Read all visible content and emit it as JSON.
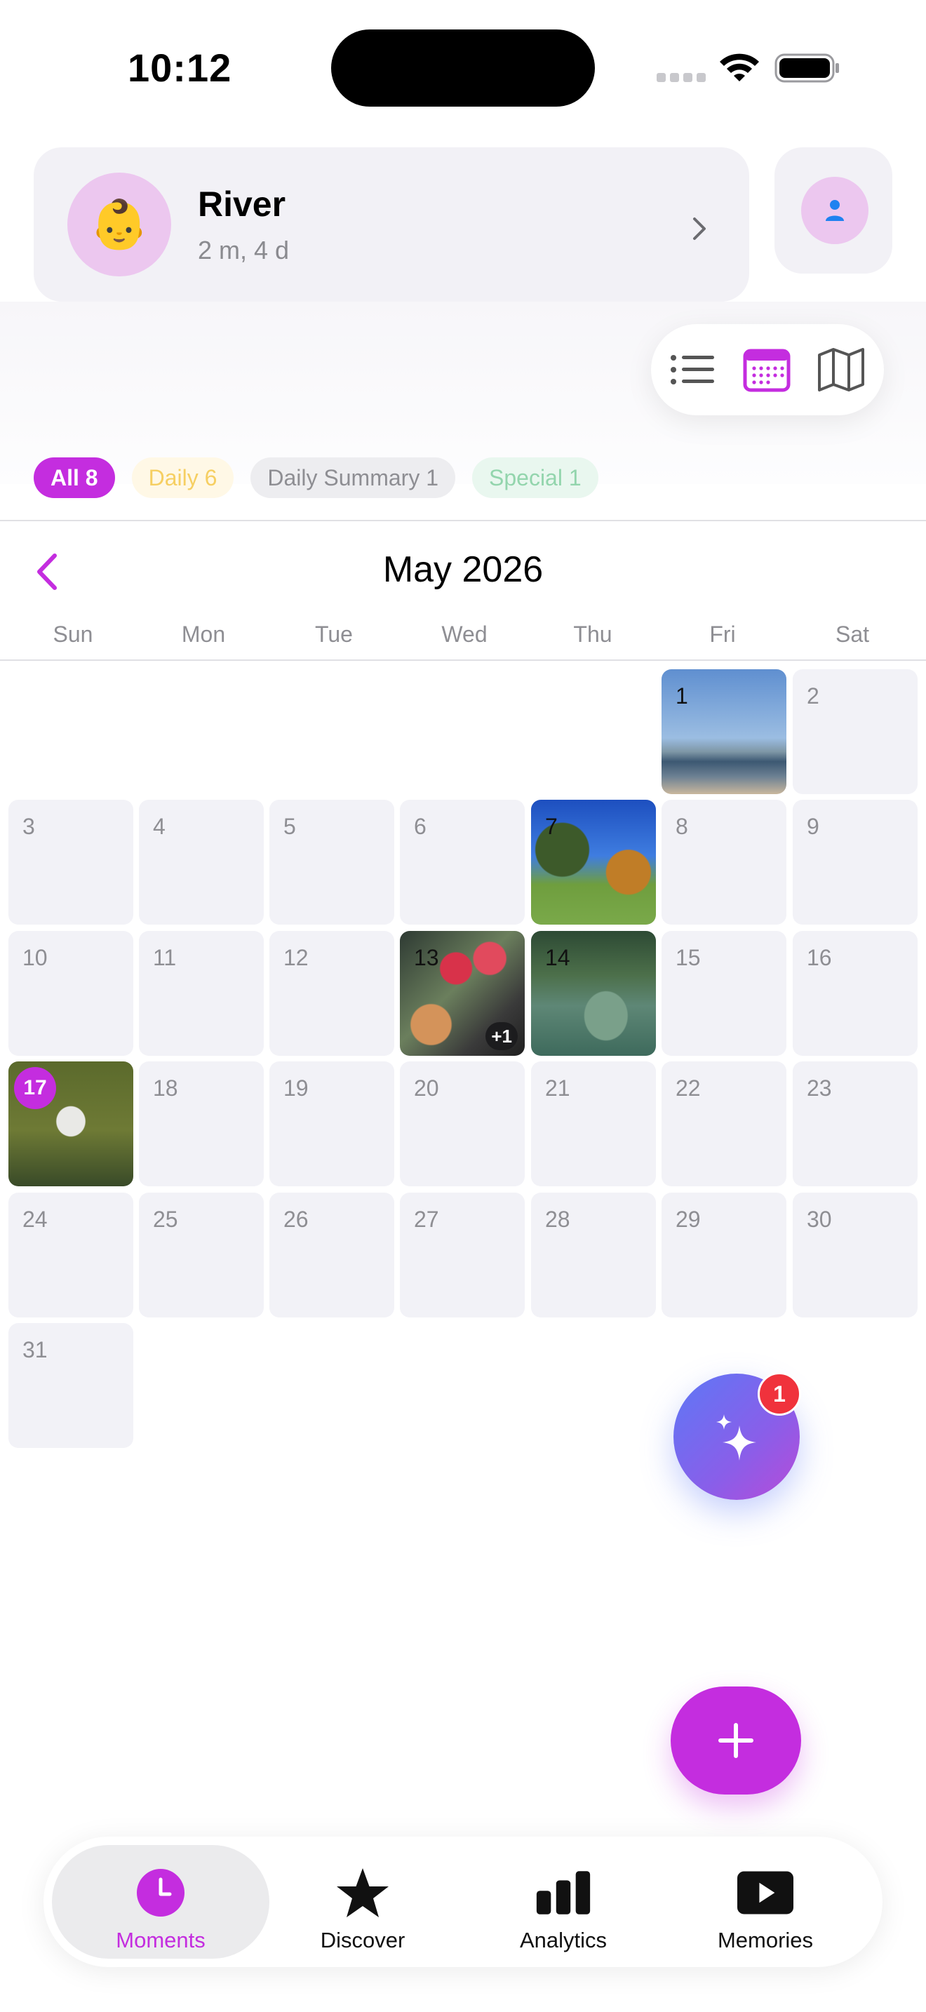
{
  "status_bar": {
    "time": "10:12"
  },
  "profile": {
    "name": "River",
    "age": "2 m, 4 d",
    "avatar_emoji": "👶"
  },
  "view_switcher": {
    "options": [
      "list-icon",
      "calendar-icon",
      "map-icon"
    ],
    "selected": "calendar"
  },
  "filters": {
    "all": "All 8",
    "daily": "Daily 6",
    "daily_summary": "Daily Summary 1",
    "special": "Special 1",
    "selected": "All 8"
  },
  "calendar": {
    "month": "May 2026",
    "weekdays": [
      "Sun",
      "Mon",
      "Tue",
      "Wed",
      "Thu",
      "Fri",
      "Sat"
    ],
    "days": {
      "d1": "1",
      "d2": "2",
      "d3": "3",
      "d4": "4",
      "d5": "5",
      "d6": "6",
      "d7": "7",
      "d8": "8",
      "d9": "9",
      "d10": "10",
      "d11": "11",
      "d12": "12",
      "d13": "13",
      "d14": "14",
      "d15": "15",
      "d16": "16",
      "d17": "17",
      "d18": "18",
      "d19": "19",
      "d20": "20",
      "d21": "21",
      "d22": "22",
      "d23": "23",
      "d24": "24",
      "d25": "25",
      "d26": "26",
      "d27": "27",
      "d28": "28",
      "d29": "29",
      "d30": "30",
      "d31": "31"
    },
    "extra_count_13": "+1",
    "today": "17"
  },
  "ai_button": {
    "badge": "1"
  },
  "tabs": {
    "moments": "Moments",
    "discover": "Discover",
    "analytics": "Analytics",
    "memories": "Memories",
    "active": "Moments"
  },
  "colors": {
    "accent": "#c42ddf",
    "badge": "#f0323c",
    "ai_gradient_start": "#5d78f6"
  }
}
